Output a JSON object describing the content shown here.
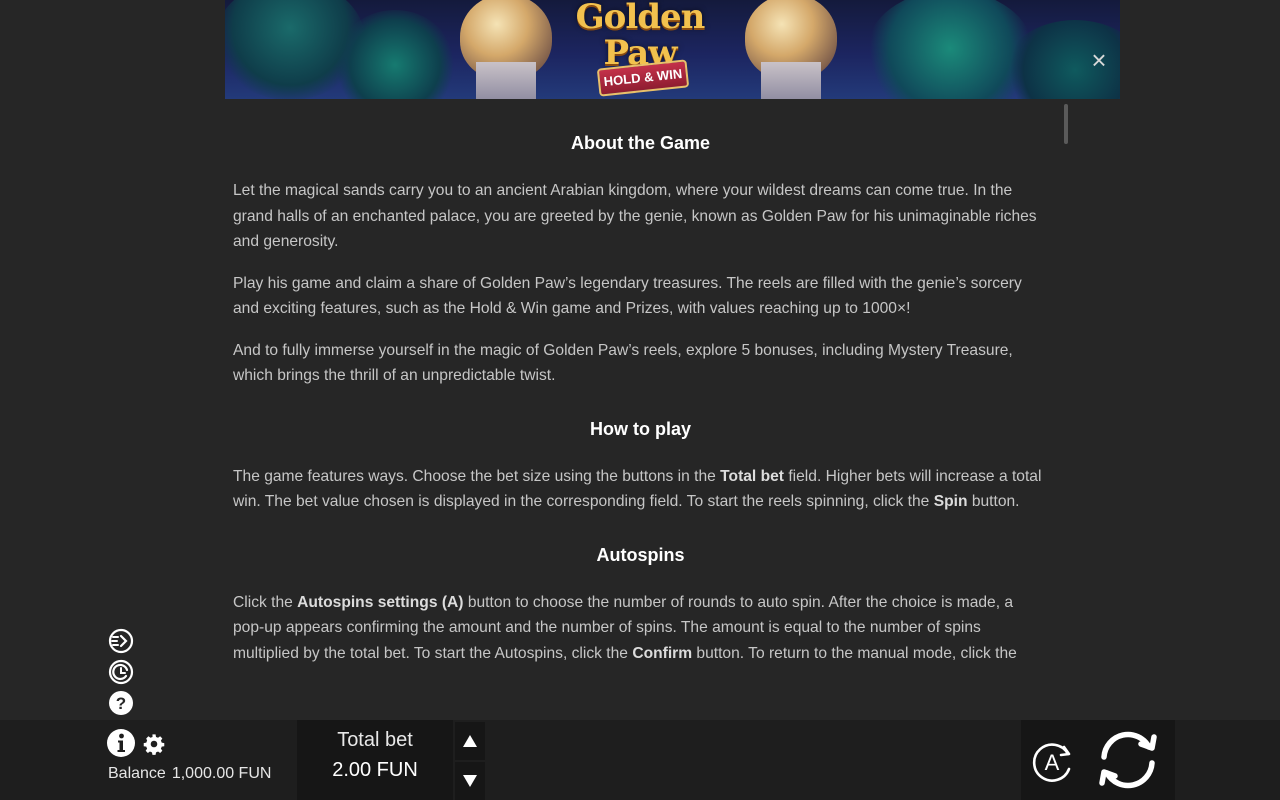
{
  "banner": {
    "logo_line1": "Golden",
    "logo_line2": "Paw",
    "logo_tag": "HOLD & WIN"
  },
  "dialog": {
    "close_label": "×"
  },
  "rules": {
    "about_title": "About the Game",
    "about_p1": "Let the magical sands carry you to an ancient Arabian kingdom, where your wildest dreams can come true. In the grand halls of an enchanted palace, you are greeted by the genie, known as Golden Paw for his unimaginable riches and generosity.",
    "about_p2": "Play his game and claim a share of Golden Paw’s legendary treasures. The reels are filled with the genie’s sorcery and exciting features, such as the Hold & Win game and Prizes, with values reaching up to 1000×!",
    "about_p3": "And to fully immerse yourself in the magic of Golden Paw’s reels, explore 5 bonuses, including Mystery Treasure, which brings the thrill of an unpredictable twist.",
    "how_title": "How to play",
    "how_p1_a": "The game features ways. Choose the bet size using the buttons in the ",
    "how_p1_b": "Total bet",
    "how_p1_c": " field. Higher bets will increase a total win. The bet value chosen is displayed in the corresponding field. To start the reels spinning, click the ",
    "how_p1_d": "Spin",
    "how_p1_e": " button.",
    "auto_title": "Autospins",
    "auto_p1_a": "Click the ",
    "auto_p1_b": "Autospins settings (A)",
    "auto_p1_c": " button to choose the number of rounds to auto spin. After the choice is made, a pop-up appears confirming the amount and the number of spins. The amount is equal to the number of spins multiplied by the total bet. To start the Autospins, click the ",
    "auto_p1_d": "Confirm",
    "auto_p1_e": " button. To return to the manual mode, click the"
  },
  "side_icons": [
    "fast-spin-icon",
    "turbo-icon",
    "help-icon"
  ],
  "bottom": {
    "balance_label": "Balance",
    "balance_value": "1,000.00 FUN",
    "total_bet_label": "Total bet",
    "total_bet_value": "2.00 FUN",
    "auto_label": "A"
  },
  "colors": {
    "background": "#262626",
    "bottom_bar": "#1e1e1e",
    "panel": "#161616",
    "heading": "#ffffff",
    "body_text": "#c6c6c6"
  }
}
